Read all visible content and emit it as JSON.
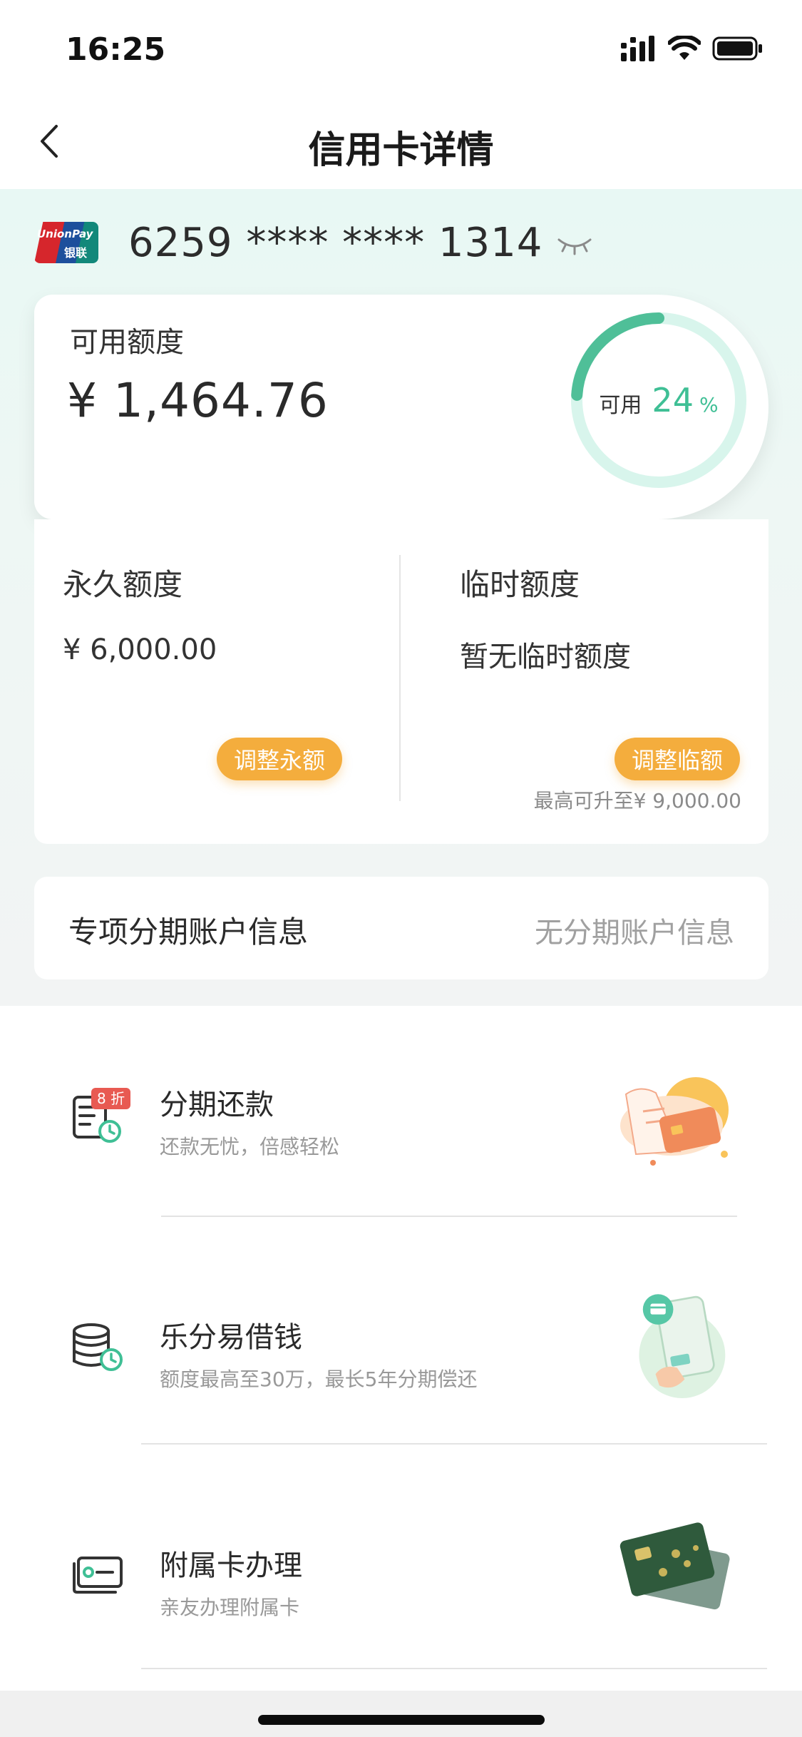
{
  "status_bar": {
    "time": "16:25"
  },
  "nav": {
    "title": "信用卡详情"
  },
  "card": {
    "number_masked": "6259 **** **** 1314",
    "logo_text_en": "UnionPay",
    "logo_text_cn": "银联"
  },
  "available": {
    "label": "可用额度",
    "amount": "¥ 1,464.76",
    "ring_prefix": "可用",
    "ring_percent": "24",
    "ring_percent_sign": "%",
    "ring_fraction": 0.24
  },
  "limits": {
    "permanent_label": "永久额度",
    "permanent_value": "¥ 6,000.00",
    "permanent_button": "调整永额",
    "temporary_label": "临时额度",
    "temporary_value": "暂无临时额度",
    "temporary_button": "调整临额",
    "max_hint": "最高可升至¥ 9,000.00"
  },
  "installment_account": {
    "label": "专项分期账户信息",
    "value": "无分期账户信息"
  },
  "services": [
    {
      "title": "分期还款",
      "subtitle": "还款无忧，倍感轻松",
      "badge": "8 折",
      "icon": "bill-clock-icon"
    },
    {
      "title": "乐分易借钱",
      "subtitle": "额度最高至30万，最长5年分期偿还",
      "icon": "coins-clock-icon"
    },
    {
      "title": "附属卡办理",
      "subtitle": "亲友办理附属卡",
      "icon": "cards-icon"
    }
  ],
  "colors": {
    "accent_green": "#3fbf95",
    "ring_track": "#d8f5ec",
    "button_orange": "#f4ad3d",
    "badge_red": "#e85a52"
  }
}
